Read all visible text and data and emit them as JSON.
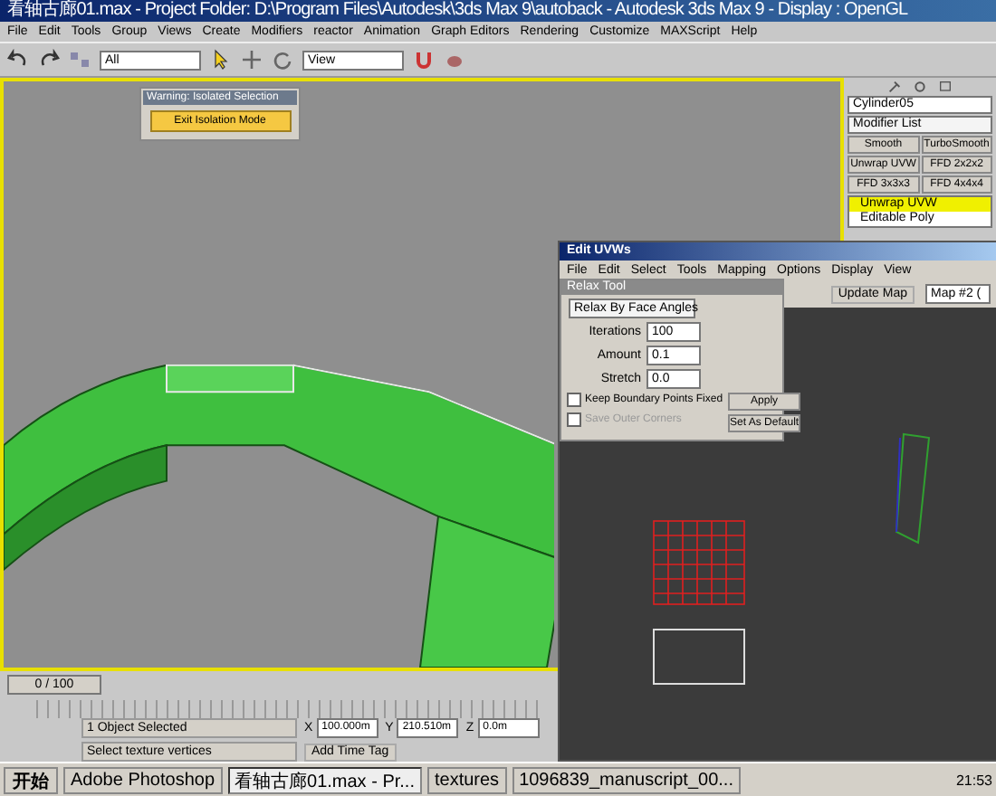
{
  "window": {
    "title": "看轴古廊01.max   - Project Folder: D:\\Program Files\\Autodesk\\3ds Max 9\\autoback   - Autodesk 3ds Max 9   - Display : OpenGL"
  },
  "menu": [
    "File",
    "Edit",
    "Tools",
    "Group",
    "Views",
    "Create",
    "Modifiers",
    "reactor",
    "Animation",
    "Graph Editors",
    "Rendering",
    "Customize",
    "MAXScript",
    "Help"
  ],
  "toolbar": {
    "selection_filter": "All",
    "reference_coord": "View"
  },
  "isolation_dialog": {
    "title": "Warning: Isolated Selection",
    "button": "Exit Isolation Mode"
  },
  "command_panel": {
    "object_name": "Cylinder05",
    "modifier_list": "Modifier List",
    "modifier_buttons": [
      "Smooth",
      "TurboSmooth",
      "Unwrap UVW",
      "FFD 2x2x2",
      "FFD 3x3x3",
      "FFD 4x4x4"
    ],
    "stack": [
      {
        "label": "Unwrap UVW",
        "selected": true
      },
      {
        "label": "Editable Poly",
        "selected": false
      }
    ]
  },
  "edit_uvws": {
    "title": "Edit UVWs",
    "menu": [
      "File",
      "Edit",
      "Select",
      "Tools",
      "Mapping",
      "Options",
      "Display",
      "View"
    ],
    "update_map": "Update Map",
    "map_select": "Map #2 (",
    "relax_tool": {
      "title": "Relax Tool",
      "method": "Relax By Face Angles",
      "params": [
        {
          "label": "Iterations",
          "value": "100"
        },
        {
          "label": "Amount",
          "value": "0.1"
        },
        {
          "label": "Stretch",
          "value": "0.0"
        }
      ],
      "options": [
        {
          "label": "Keep Boundary Points Fixed",
          "checked": false,
          "disabled": false
        },
        {
          "label": "Save Outer Corners",
          "checked": false,
          "disabled": true
        }
      ],
      "buttons": [
        "Apply",
        "Set As Default"
      ]
    }
  },
  "timeline": {
    "position": "0 / 100"
  },
  "status": {
    "selection": "1 Object Selected",
    "prompt": "Select texture vertices",
    "coords": [
      {
        "axis": "X",
        "value": "100.000m"
      },
      {
        "axis": "Y",
        "value": "210.510m"
      },
      {
        "axis": "Z",
        "value": "0.0m"
      }
    ],
    "time_tag": "Add Time Tag"
  },
  "taskbar": {
    "start": "开始",
    "tasks": [
      {
        "label": "Adobe Photoshop",
        "selected": false
      },
      {
        "label": "看轴古廊01.max - Pr...",
        "selected": true
      },
      {
        "label": "textures",
        "selected": false
      },
      {
        "label": "1096839_manuscript_00...",
        "selected": false
      }
    ],
    "clock": "21:53"
  }
}
